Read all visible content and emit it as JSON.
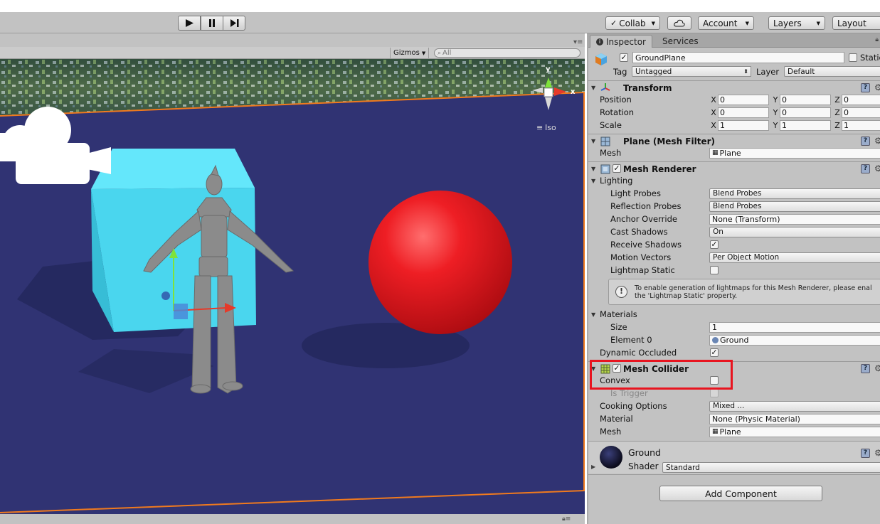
{
  "toolbar": {
    "play_icon": "play-icon",
    "pause_icon": "pause-icon",
    "step_icon": "step-icon",
    "collab_label": "Collab",
    "account_label": "Account",
    "layers_label": "Layers",
    "layout_label": "Layout"
  },
  "scene": {
    "gizmos_label": "Gizmos",
    "search_placeholder": "All",
    "projection_label": "Iso",
    "axis_x": "x",
    "axis_y": "y"
  },
  "inspector": {
    "tabs": [
      "Inspector",
      "Services"
    ],
    "object_name": "GroundPlane",
    "static_label": "Static",
    "tag_label": "Tag",
    "tag_value": "Untagged",
    "layer_label": "Layer",
    "layer_value": "Default",
    "transform": {
      "title": "Transform",
      "rows": [
        {
          "label": "Position",
          "x": "0",
          "y": "0",
          "z": "0"
        },
        {
          "label": "Rotation",
          "x": "0",
          "y": "0",
          "z": "0"
        },
        {
          "label": "Scale",
          "x": "1",
          "y": "1",
          "z": "1"
        }
      ],
      "axis_x": "X",
      "axis_y": "Y",
      "axis_z": "Z"
    },
    "mesh_filter": {
      "title": "Plane (Mesh Filter)",
      "mesh_label": "Mesh",
      "mesh_value": "Plane"
    },
    "mesh_renderer": {
      "title": "Mesh Renderer",
      "lighting_label": "Lighting",
      "light_probes_label": "Light Probes",
      "light_probes_value": "Blend Probes",
      "reflection_probes_label": "Reflection Probes",
      "reflection_probes_value": "Blend Probes",
      "anchor_override_label": "Anchor Override",
      "anchor_override_value": "None (Transform)",
      "cast_shadows_label": "Cast Shadows",
      "cast_shadows_value": "On",
      "receive_shadows_label": "Receive Shadows",
      "motion_vectors_label": "Motion Vectors",
      "motion_vectors_value": "Per Object Motion",
      "lightmap_static_label": "Lightmap Static",
      "help_line1": "To enable generation of lightmaps for this Mesh Renderer, please enal",
      "help_line2": "the 'Lightmap Static' property.",
      "materials_label": "Materials",
      "size_label": "Size",
      "size_value": "1",
      "element0_label": "Element 0",
      "element0_value": "Ground",
      "dynamic_occluded_label": "Dynamic Occluded"
    },
    "mesh_collider": {
      "title": "Mesh Collider",
      "convex_label": "Convex",
      "is_trigger_label": "Is Trigger",
      "cooking_options_label": "Cooking Options",
      "cooking_options_value": "Mixed ...",
      "material_label": "Material",
      "material_value": "None (Physic Material)",
      "mesh_label": "Mesh",
      "mesh_value": "Plane"
    },
    "material": {
      "name": "Ground",
      "shader_label": "Shader",
      "shader_value": "Standard"
    },
    "add_component_label": "Add Component"
  },
  "colors": {
    "highlight": "#e8141f",
    "scene_floor": "#303373",
    "cube": "#4ad6ee",
    "sphere": "#e8151c"
  }
}
